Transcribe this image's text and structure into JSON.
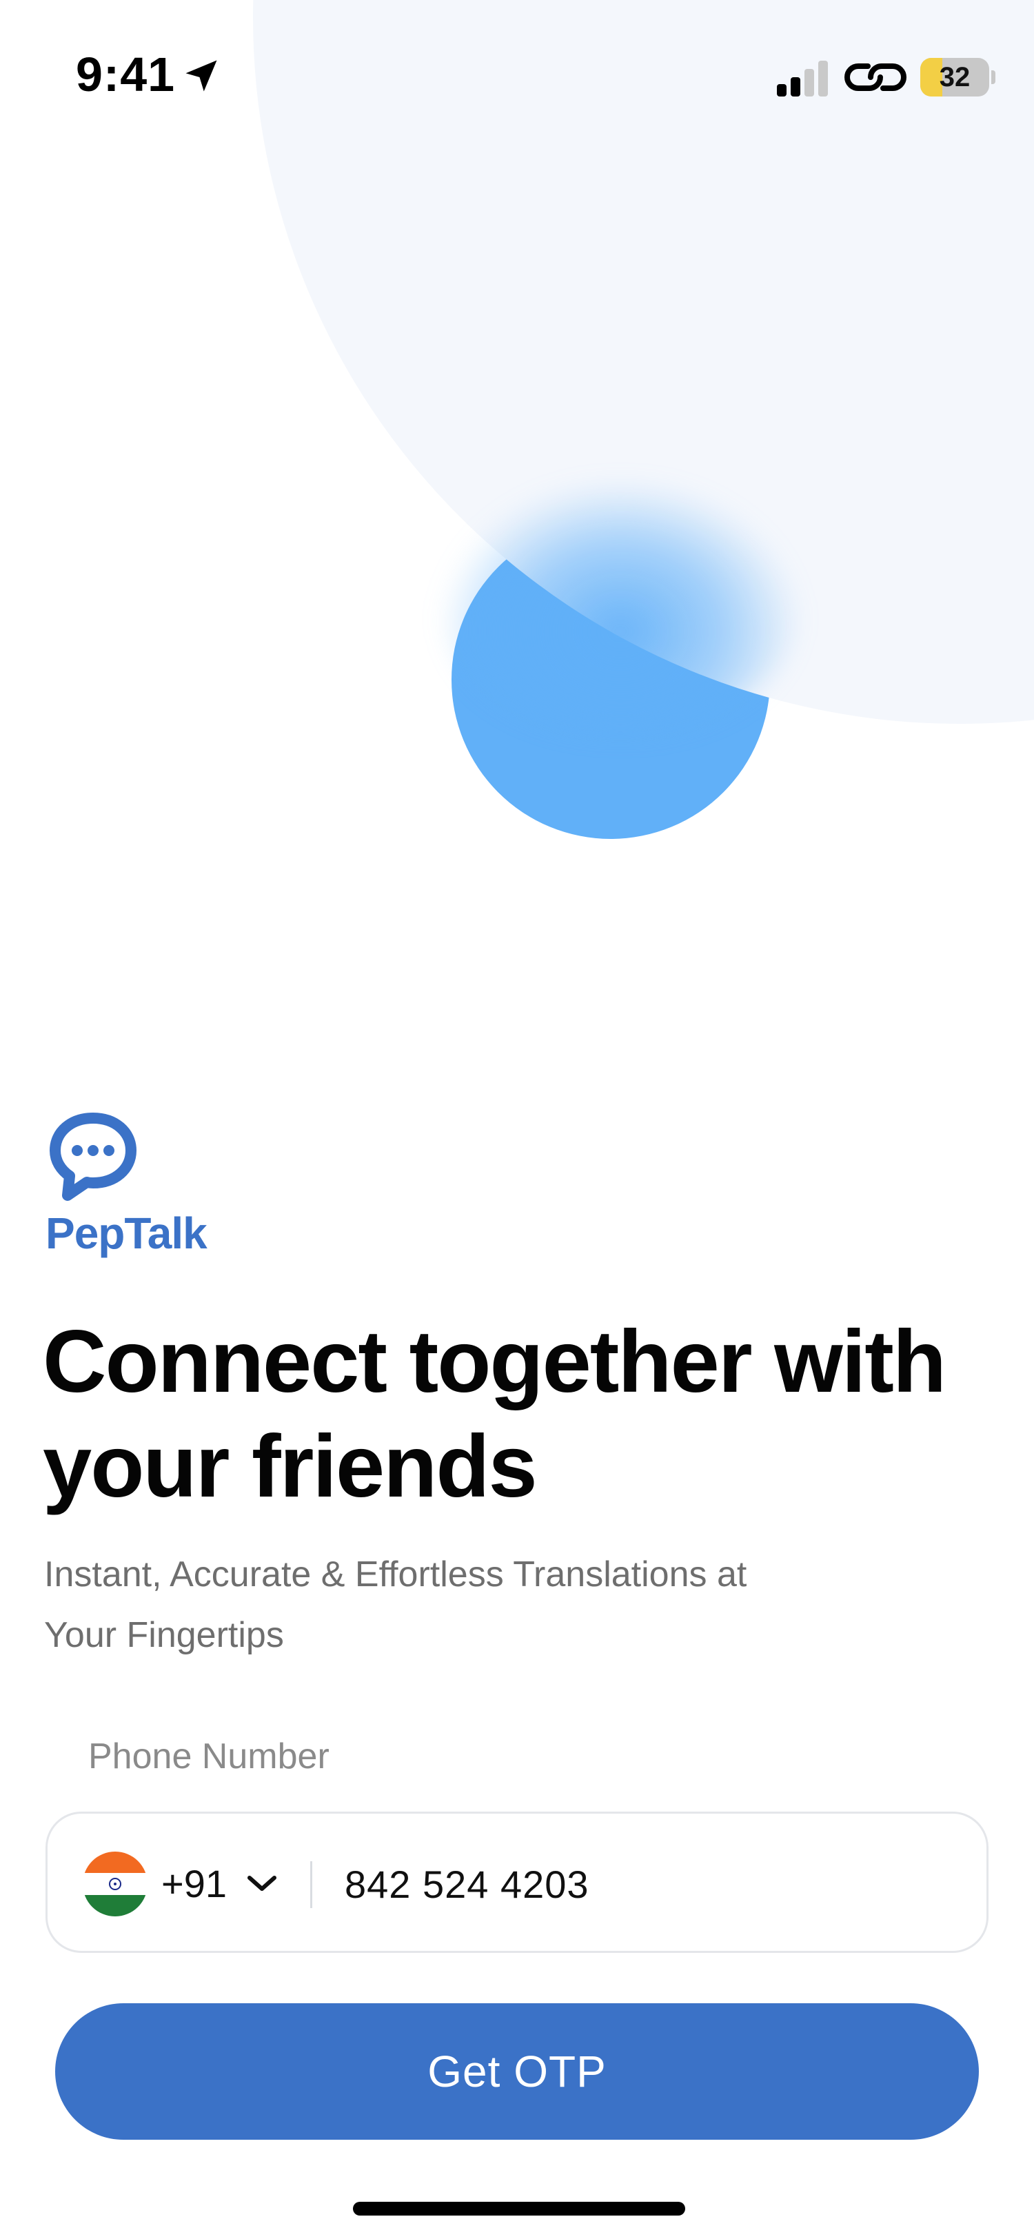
{
  "status_bar": {
    "time": "9:41",
    "battery_level": "32",
    "battery_percent": 32,
    "icons": [
      "location-arrow-icon",
      "cellular-signal-icon",
      "link-icon",
      "battery-icon"
    ]
  },
  "brand": {
    "name": "PepTalk",
    "logo": "chat-bubble-icon",
    "color": "#3b72c7"
  },
  "main": {
    "headline": "Connect together with your friends",
    "subtitle": "Instant, Accurate & Effortless Translations at Your Fingertips"
  },
  "phone": {
    "label": "Phone Number",
    "country_flag": "india-flag-icon",
    "dial_code": "+91",
    "value": "842 524 4203"
  },
  "actions": {
    "get_otp_label": "Get OTP"
  },
  "colors": {
    "accent": "#3b72c7",
    "decor_blue": "#61b0f8",
    "decor_light": "#f4f7fc",
    "battery_yellow": "#f3cf45"
  }
}
